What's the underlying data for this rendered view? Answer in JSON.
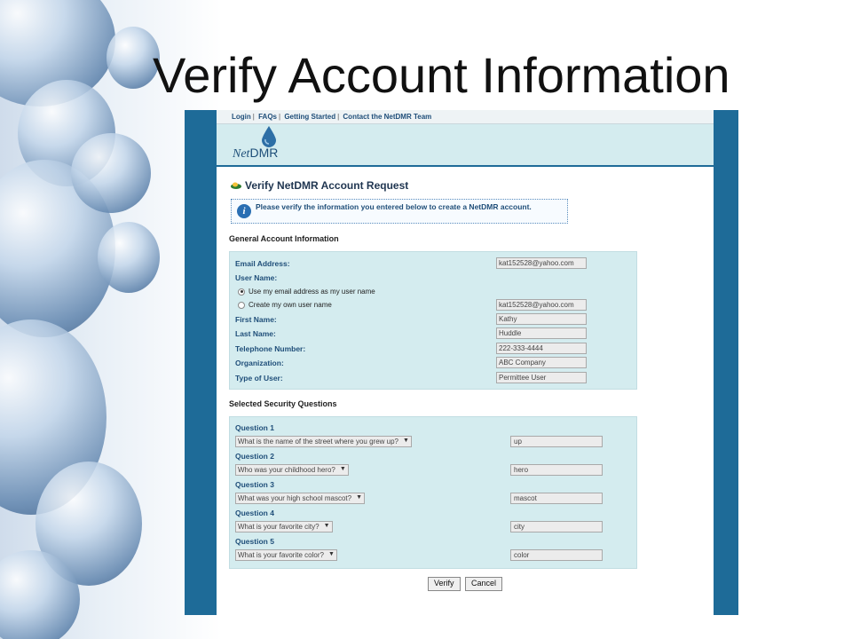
{
  "slide": {
    "title": "Verify Account Information"
  },
  "nav": [
    "Login",
    "FAQs",
    "Getting Started",
    "Contact the NetDMR Team"
  ],
  "logo": {
    "prefix": "Net",
    "suffix": "DMR"
  },
  "page": {
    "heading": "Verify NetDMR Account Request",
    "notice": "Please verify the information you entered below to create a NetDMR account."
  },
  "general": {
    "section_title": "General Account Information",
    "email_label": "Email Address:",
    "email_value": "kat152528@yahoo.com",
    "username_label": "User Name:",
    "radio_email": "Use my email address as my user name",
    "radio_own": "Create my own user name",
    "own_username_value": "kat152528@yahoo.com",
    "first_label": "First Name:",
    "first_value": "Kathy",
    "last_label": "Last Name:",
    "last_value": "Huddle",
    "phone_label": "Telephone Number:",
    "phone_value": "222-333-4444",
    "org_label": "Organization:",
    "org_value": "ABC Company",
    "type_label": "Type of User:",
    "type_value": "Permittee User"
  },
  "security": {
    "section_title": "Selected Security Questions",
    "questions": [
      {
        "label": "Question 1",
        "question": "What is the name of the street where you grew up?",
        "answer": "up"
      },
      {
        "label": "Question 2",
        "question": "Who was your childhood hero?",
        "answer": "hero"
      },
      {
        "label": "Question 3",
        "question": "What was your high school mascot?",
        "answer": "mascot"
      },
      {
        "label": "Question 4",
        "question": "What is your favorite city?",
        "answer": "city"
      },
      {
        "label": "Question 5",
        "question": "What is your favorite color?",
        "answer": "color"
      }
    ]
  },
  "buttons": {
    "verify": "Verify",
    "cancel": "Cancel"
  },
  "colors": {
    "frame": "#1e6b98",
    "panel": "#d4ecef",
    "label": "#1f4e79"
  }
}
